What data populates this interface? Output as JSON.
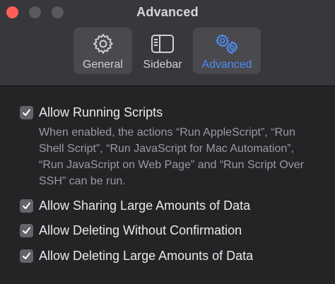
{
  "window": {
    "title": "Advanced",
    "traffic_lights": [
      "close",
      "minimize",
      "zoom"
    ],
    "accent_color": "#4b8ef6"
  },
  "toolbar": {
    "tabs": [
      {
        "label": "General",
        "icon": "gear-icon",
        "selected": false
      },
      {
        "label": "Sidebar",
        "icon": "sidebar-icon",
        "selected": false
      },
      {
        "label": "Advanced",
        "icon": "gears-icon",
        "selected": true
      }
    ]
  },
  "settings": {
    "allow_running_scripts": {
      "label": "Allow Running Scripts",
      "checked": true,
      "description": "When enabled, the actions “Run AppleScript”, “Run Shell Script”, “Run JavaScript for Mac Automation”, “Run JavaScript on Web Page” and “Run Script Over SSH” can be run."
    },
    "allow_sharing_large_data": {
      "label": "Allow Sharing Large Amounts of Data",
      "checked": true
    },
    "allow_deleting_without_confirmation": {
      "label": "Allow Deleting Without Confirmation",
      "checked": true
    },
    "allow_deleting_large_data": {
      "label": "Allow Deleting Large Amounts of Data",
      "checked": true
    }
  }
}
